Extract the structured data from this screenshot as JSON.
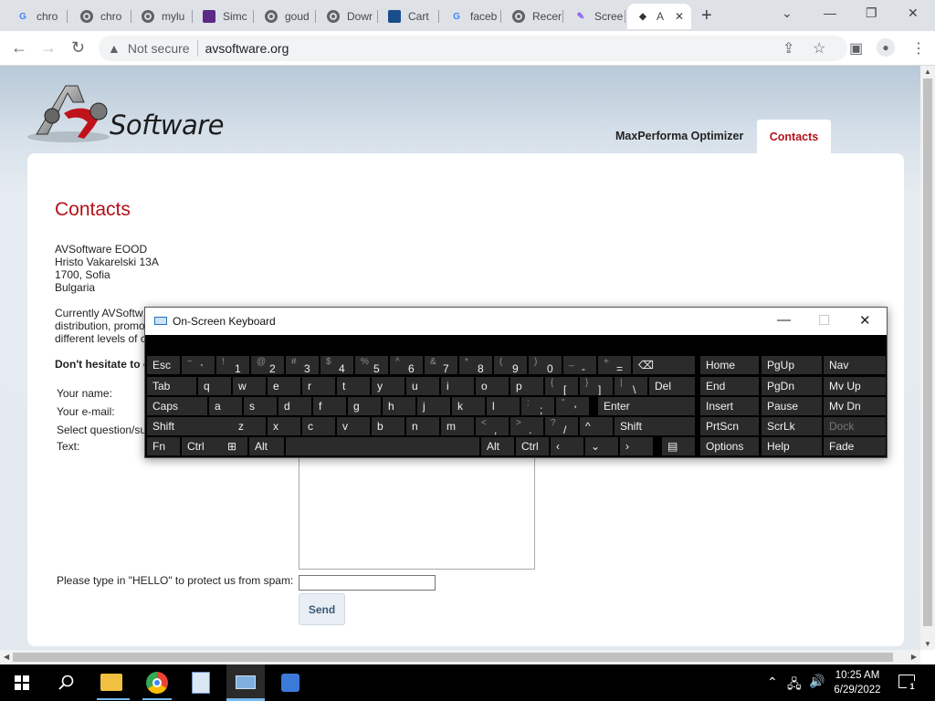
{
  "browser": {
    "tabs": [
      {
        "title": "chro",
        "icon": "google-icon"
      },
      {
        "title": "chro",
        "icon": "chrome-icon"
      },
      {
        "title": "mylu",
        "icon": "chrome-icon"
      },
      {
        "title": "Simc",
        "icon": "vst-icon"
      },
      {
        "title": "goud",
        "icon": "chrome-icon"
      },
      {
        "title": "Dowr",
        "icon": "chrome-icon"
      },
      {
        "title": "Cart",
        "icon": "cart-icon"
      },
      {
        "title": "faceb",
        "icon": "google-icon"
      },
      {
        "title": "Recer",
        "icon": "chrome-icon"
      },
      {
        "title": "Scree",
        "icon": "pen-icon"
      },
      {
        "title": "A",
        "icon": "avsoftware-icon",
        "active": true
      }
    ],
    "address": {
      "security": "Not secure",
      "url": "avsoftware.org"
    }
  },
  "site": {
    "logo_text": "Software",
    "nav": [
      {
        "label": "MaxPerforma Optimizer"
      },
      {
        "label": "Contacts",
        "active": true
      }
    ],
    "heading": "Contacts",
    "address_lines": [
      "AVSoftware EOOD",
      "Hristo Vakarelski 13A",
      "1700, Sofia",
      "Bulgaria"
    ],
    "intro_lines": [
      "Currently AVSoftw",
      "distribution, promo",
      "different levels of c"
    ],
    "hesitate": "Don't hesitate to c",
    "form": {
      "name_label": "Your name:",
      "email_label": "Your e-mail:",
      "question_label": "Select question/su",
      "text_label": "Text:",
      "spam_label": "Please type in \"HELLO\" to protect us from spam:",
      "send_label": "Send"
    }
  },
  "osk": {
    "title": "On-Screen Keyboard",
    "rows": [
      [
        {
          "k": "Esc"
        },
        {
          "a": "~",
          "k": "`"
        },
        {
          "a": "!",
          "k": "1"
        },
        {
          "a": "@",
          "k": "2"
        },
        {
          "a": "#",
          "k": "3"
        },
        {
          "a": "$",
          "k": "4"
        },
        {
          "a": "%",
          "k": "5"
        },
        {
          "a": "^",
          "k": "6"
        },
        {
          "a": "&",
          "k": "7"
        },
        {
          "a": "*",
          "k": "8"
        },
        {
          "a": "(",
          "k": "9"
        },
        {
          "a": ")",
          "k": "0"
        },
        {
          "a": "_",
          "k": "-"
        },
        {
          "a": "+",
          "k": "="
        },
        {
          "k": "⌫"
        }
      ],
      [
        {
          "k": "Tab"
        },
        {
          "k": "q"
        },
        {
          "k": "w"
        },
        {
          "k": "e"
        },
        {
          "k": "r"
        },
        {
          "k": "t"
        },
        {
          "k": "y"
        },
        {
          "k": "u"
        },
        {
          "k": "i"
        },
        {
          "k": "o"
        },
        {
          "k": "p"
        },
        {
          "a": "{",
          "k": "["
        },
        {
          "a": "}",
          "k": "]"
        },
        {
          "a": "|",
          "k": "\\"
        },
        {
          "k": "Del"
        }
      ],
      [
        {
          "k": "Caps"
        },
        {
          "k": "a"
        },
        {
          "k": "s"
        },
        {
          "k": "d"
        },
        {
          "k": "f"
        },
        {
          "k": "g"
        },
        {
          "k": "h"
        },
        {
          "k": "j"
        },
        {
          "k": "k"
        },
        {
          "k": "l"
        },
        {
          "a": ":",
          "k": ";"
        },
        {
          "a": "\"",
          "k": "'"
        },
        {
          "k": "Enter"
        }
      ],
      [
        {
          "k": "Shift"
        },
        {
          "k": "z"
        },
        {
          "k": "x"
        },
        {
          "k": "c"
        },
        {
          "k": "v"
        },
        {
          "k": "b"
        },
        {
          "k": "n"
        },
        {
          "k": "m"
        },
        {
          "a": "<",
          "k": ","
        },
        {
          "a": ">",
          "k": "."
        },
        {
          "a": "?",
          "k": "/"
        },
        {
          "k": "^"
        },
        {
          "k": "Shift"
        }
      ],
      [
        {
          "k": "Fn"
        },
        {
          "k": "Ctrl"
        },
        {
          "k": "⊞"
        },
        {
          "k": "Alt"
        },
        {
          "k": ""
        },
        {
          "k": "Alt"
        },
        {
          "k": "Ctrl"
        },
        {
          "k": "‹"
        },
        {
          "k": "⌄"
        },
        {
          "k": "›"
        },
        {
          "k": "▤"
        }
      ]
    ],
    "nav_keys": [
      [
        "Home",
        "PgUp",
        "Nav"
      ],
      [
        "End",
        "PgDn",
        "Mv Up"
      ],
      [
        "Insert",
        "Pause",
        "Mv Dn"
      ],
      [
        "PrtScn",
        "ScrLk",
        "Dock"
      ],
      [
        "Options",
        "Help",
        "Fade"
      ]
    ],
    "disabled": [
      "Dock"
    ]
  },
  "taskbar": {
    "time": "10:25 AM",
    "date": "6/29/2022",
    "notification_count": "1"
  }
}
